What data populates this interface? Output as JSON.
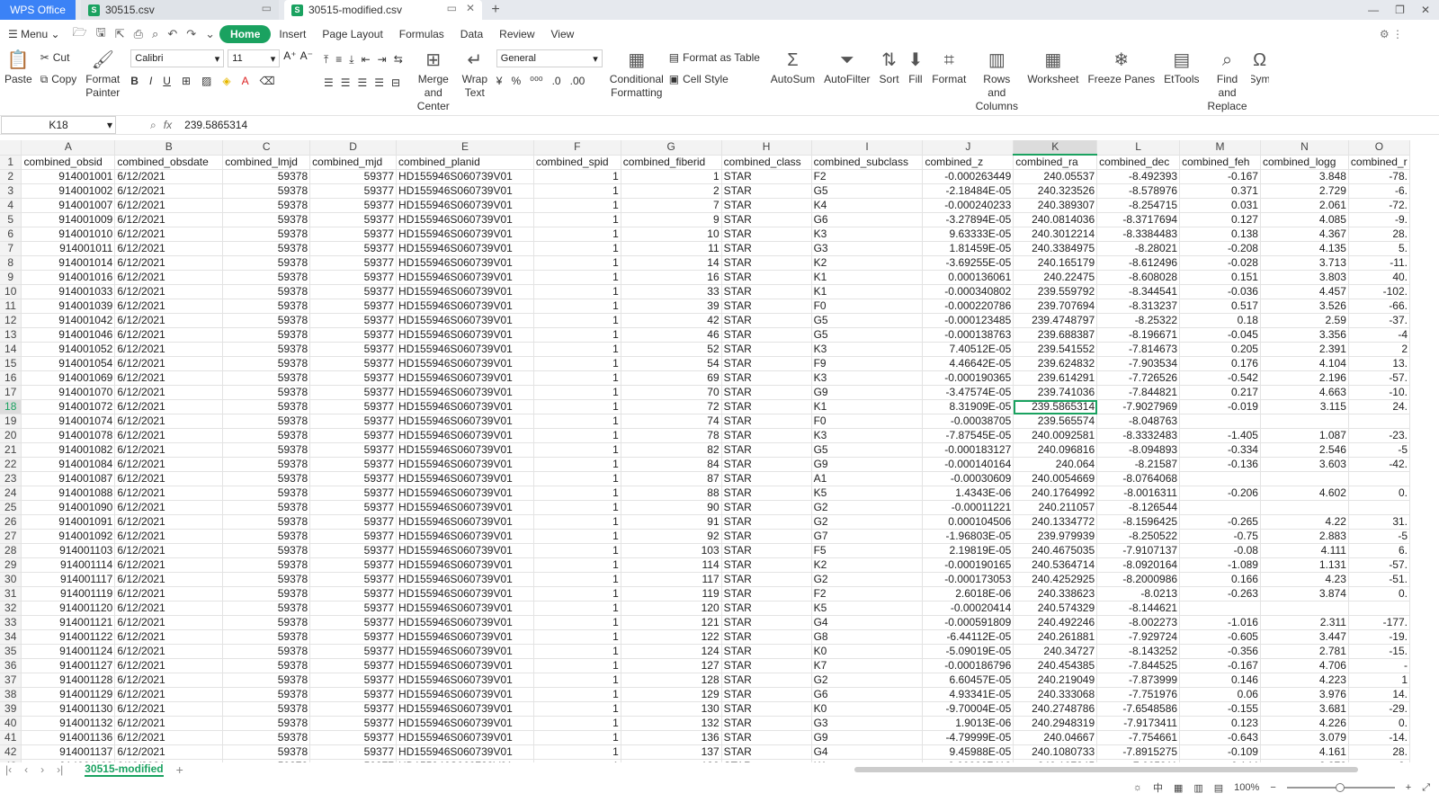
{
  "titlebar": {
    "app": "WPS Office",
    "tabs": [
      {
        "name": "30515.csv",
        "active": false
      },
      {
        "name": "30515-modified.csv",
        "active": true
      }
    ]
  },
  "menu": {
    "menu_label": "Menu",
    "items": [
      "Home",
      "Insert",
      "Page Layout",
      "Formulas",
      "Data",
      "Review",
      "View"
    ]
  },
  "ribbon": {
    "paste": "Paste",
    "cut": "Cut",
    "copy": "Copy",
    "format_painter": "Format Painter",
    "font_name": "Calibri",
    "font_size": "11",
    "merge_center": "Merge and Center",
    "wrap_text": "Wrap Text",
    "number_format": "General",
    "conditional": "Conditional Formatting",
    "format_table": "Format as Table",
    "cell_style": "Cell Style",
    "autosum": "AutoSum",
    "autofilter": "AutoFilter",
    "sort": "Sort",
    "fill": "Fill",
    "format": "Format",
    "rows_cols": "Rows and Columns",
    "worksheet": "Worksheet",
    "freeze": "Freeze Panes",
    "ettools": "EtTools",
    "find_replace": "Find and Replace",
    "sym": "Sym"
  },
  "formula": {
    "cell_ref": "K18",
    "fx": "fx",
    "value": "239.5865314"
  },
  "columns": [
    "A",
    "B",
    "C",
    "D",
    "E",
    "F",
    "G",
    "H",
    "I",
    "J",
    "K",
    "L",
    "M",
    "N",
    "O"
  ],
  "header": [
    "combined_obsid",
    "combined_obsdate",
    "combined_lmjd",
    "combined_mjd",
    "combined_planid",
    "combined_spid",
    "combined_fiberid",
    "combined_class",
    "combined_subclass",
    "combined_z",
    "combined_ra",
    "combined_dec",
    "combined_feh",
    "combined_logg",
    "combined_r"
  ],
  "rows": [
    [
      "914001001",
      "6/12/2021",
      "59378",
      "59377",
      "HD155946S060739V01",
      "1",
      "1",
      "STAR",
      "F2",
      "-0.000263449",
      "240.05537",
      "-8.492393",
      "-0.167",
      "3.848",
      "-78."
    ],
    [
      "914001002",
      "6/12/2021",
      "59378",
      "59377",
      "HD155946S060739V01",
      "1",
      "2",
      "STAR",
      "G5",
      "-2.18484E-05",
      "240.323526",
      "-8.578976",
      "0.371",
      "2.729",
      "-6."
    ],
    [
      "914001007",
      "6/12/2021",
      "59378",
      "59377",
      "HD155946S060739V01",
      "1",
      "7",
      "STAR",
      "K4",
      "-0.000240233",
      "240.389307",
      "-8.254715",
      "0.031",
      "2.061",
      "-72."
    ],
    [
      "914001009",
      "6/12/2021",
      "59378",
      "59377",
      "HD155946S060739V01",
      "1",
      "9",
      "STAR",
      "G6",
      "-3.27894E-05",
      "240.0814036",
      "-8.3717694",
      "0.127",
      "4.085",
      "-9."
    ],
    [
      "914001010",
      "6/12/2021",
      "59378",
      "59377",
      "HD155946S060739V01",
      "1",
      "10",
      "STAR",
      "K3",
      "9.63333E-05",
      "240.3012214",
      "-8.3384483",
      "0.138",
      "4.367",
      "28."
    ],
    [
      "914001011",
      "6/12/2021",
      "59378",
      "59377",
      "HD155946S060739V01",
      "1",
      "11",
      "STAR",
      "G3",
      "1.81459E-05",
      "240.3384975",
      "-8.28021",
      "-0.208",
      "4.135",
      "5."
    ],
    [
      "914001014",
      "6/12/2021",
      "59378",
      "59377",
      "HD155946S060739V01",
      "1",
      "14",
      "STAR",
      "K2",
      "-3.69255E-05",
      "240.165179",
      "-8.612496",
      "-0.028",
      "3.713",
      "-11."
    ],
    [
      "914001016",
      "6/12/2021",
      "59378",
      "59377",
      "HD155946S060739V01",
      "1",
      "16",
      "STAR",
      "K1",
      "0.000136061",
      "240.22475",
      "-8.608028",
      "0.151",
      "3.803",
      "40."
    ],
    [
      "914001033",
      "6/12/2021",
      "59378",
      "59377",
      "HD155946S060739V01",
      "1",
      "33",
      "STAR",
      "K1",
      "-0.000340802",
      "239.559792",
      "-8.344541",
      "-0.036",
      "4.457",
      "-102."
    ],
    [
      "914001039",
      "6/12/2021",
      "59378",
      "59377",
      "HD155946S060739V01",
      "1",
      "39",
      "STAR",
      "F0",
      "-0.000220786",
      "239.707694",
      "-8.313237",
      "0.517",
      "3.526",
      "-66."
    ],
    [
      "914001042",
      "6/12/2021",
      "59378",
      "59377",
      "HD155946S060739V01",
      "1",
      "42",
      "STAR",
      "G5",
      "-0.000123485",
      "239.4748797",
      "-8.25322",
      "0.18",
      "2.59",
      "-37."
    ],
    [
      "914001046",
      "6/12/2021",
      "59378",
      "59377",
      "HD155946S060739V01",
      "1",
      "46",
      "STAR",
      "G5",
      "-0.000138763",
      "239.688387",
      "-8.196671",
      "-0.045",
      "3.356",
      "-4"
    ],
    [
      "914001052",
      "6/12/2021",
      "59378",
      "59377",
      "HD155946S060739V01",
      "1",
      "52",
      "STAR",
      "K3",
      "7.40512E-05",
      "239.541552",
      "-7.814673",
      "0.205",
      "2.391",
      "2"
    ],
    [
      "914001054",
      "6/12/2021",
      "59378",
      "59377",
      "HD155946S060739V01",
      "1",
      "54",
      "STAR",
      "F9",
      "4.46642E-05",
      "239.624832",
      "-7.903534",
      "0.176",
      "4.104",
      "13."
    ],
    [
      "914001069",
      "6/12/2021",
      "59378",
      "59377",
      "HD155946S060739V01",
      "1",
      "69",
      "STAR",
      "K3",
      "-0.000190365",
      "239.614291",
      "-7.726526",
      "-0.542",
      "2.196",
      "-57."
    ],
    [
      "914001070",
      "6/12/2021",
      "59378",
      "59377",
      "HD155946S060739V01",
      "1",
      "70",
      "STAR",
      "G9",
      "-3.47574E-05",
      "239.741036",
      "-7.844821",
      "0.217",
      "4.663",
      "-10."
    ],
    [
      "914001072",
      "6/12/2021",
      "59378",
      "59377",
      "HD155946S060739V01",
      "1",
      "72",
      "STAR",
      "K1",
      "8.31909E-05",
      "239.5865314",
      "-7.9027969",
      "-0.019",
      "3.115",
      "24."
    ],
    [
      "914001074",
      "6/12/2021",
      "59378",
      "59377",
      "HD155946S060739V01",
      "1",
      "74",
      "STAR",
      "F0",
      "-0.00038705",
      "239.565574",
      "-8.048763",
      "",
      "",
      ""
    ],
    [
      "914001078",
      "6/12/2021",
      "59378",
      "59377",
      "HD155946S060739V01",
      "1",
      "78",
      "STAR",
      "K3",
      "-7.87545E-05",
      "240.0092581",
      "-8.3332483",
      "-1.405",
      "1.087",
      "-23."
    ],
    [
      "914001082",
      "6/12/2021",
      "59378",
      "59377",
      "HD155946S060739V01",
      "1",
      "82",
      "STAR",
      "G5",
      "-0.000183127",
      "240.096816",
      "-8.094893",
      "-0.334",
      "2.546",
      "-5"
    ],
    [
      "914001084",
      "6/12/2021",
      "59378",
      "59377",
      "HD155946S060739V01",
      "1",
      "84",
      "STAR",
      "G9",
      "-0.000140164",
      "240.064",
      "-8.21587",
      "-0.136",
      "3.603",
      "-42."
    ],
    [
      "914001087",
      "6/12/2021",
      "59378",
      "59377",
      "HD155946S060739V01",
      "1",
      "87",
      "STAR",
      "A1",
      "-0.00030609",
      "240.0054669",
      "-8.0764068",
      "",
      "",
      ""
    ],
    [
      "914001088",
      "6/12/2021",
      "59378",
      "59377",
      "HD155946S060739V01",
      "1",
      "88",
      "STAR",
      "K5",
      "1.4343E-06",
      "240.1764992",
      "-8.0016311",
      "-0.206",
      "4.602",
      "0."
    ],
    [
      "914001090",
      "6/12/2021",
      "59378",
      "59377",
      "HD155946S060739V01",
      "1",
      "90",
      "STAR",
      "G2",
      "-0.00011221",
      "240.211057",
      "-8.126544",
      "",
      "",
      ""
    ],
    [
      "914001091",
      "6/12/2021",
      "59378",
      "59377",
      "HD155946S060739V01",
      "1",
      "91",
      "STAR",
      "G2",
      "0.000104506",
      "240.1334772",
      "-8.1596425",
      "-0.265",
      "4.22",
      "31."
    ],
    [
      "914001092",
      "6/12/2021",
      "59378",
      "59377",
      "HD155946S060739V01",
      "1",
      "92",
      "STAR",
      "G7",
      "-1.96803E-05",
      "239.979939",
      "-8.250522",
      "-0.75",
      "2.883",
      "-5"
    ],
    [
      "914001103",
      "6/12/2021",
      "59378",
      "59377",
      "HD155946S060739V01",
      "1",
      "103",
      "STAR",
      "F5",
      "2.19819E-05",
      "240.4675035",
      "-7.9107137",
      "-0.08",
      "4.111",
      "6."
    ],
    [
      "914001114",
      "6/12/2021",
      "59378",
      "59377",
      "HD155946S060739V01",
      "1",
      "114",
      "STAR",
      "K2",
      "-0.000190165",
      "240.5364714",
      "-8.0920164",
      "-1.089",
      "1.131",
      "-57."
    ],
    [
      "914001117",
      "6/12/2021",
      "59378",
      "59377",
      "HD155946S060739V01",
      "1",
      "117",
      "STAR",
      "G2",
      "-0.000173053",
      "240.4252925",
      "-8.2000986",
      "0.166",
      "4.23",
      "-51."
    ],
    [
      "914001119",
      "6/12/2021",
      "59378",
      "59377",
      "HD155946S060739V01",
      "1",
      "119",
      "STAR",
      "F2",
      "2.6018E-06",
      "240.338623",
      "-8.0213",
      "-0.263",
      "3.874",
      "0."
    ],
    [
      "914001120",
      "6/12/2021",
      "59378",
      "59377",
      "HD155946S060739V01",
      "1",
      "120",
      "STAR",
      "K5",
      "-0.00020414",
      "240.574329",
      "-8.144621",
      "",
      "",
      ""
    ],
    [
      "914001121",
      "6/12/2021",
      "59378",
      "59377",
      "HD155946S060739V01",
      "1",
      "121",
      "STAR",
      "G4",
      "-0.000591809",
      "240.492246",
      "-8.002273",
      "-1.016",
      "2.311",
      "-177."
    ],
    [
      "914001122",
      "6/12/2021",
      "59378",
      "59377",
      "HD155946S060739V01",
      "1",
      "122",
      "STAR",
      "G8",
      "-6.44112E-05",
      "240.261881",
      "-7.929724",
      "-0.605",
      "3.447",
      "-19."
    ],
    [
      "914001124",
      "6/12/2021",
      "59378",
      "59377",
      "HD155946S060739V01",
      "1",
      "124",
      "STAR",
      "K0",
      "-5.09019E-05",
      "240.34727",
      "-8.143252",
      "-0.356",
      "2.781",
      "-15."
    ],
    [
      "914001127",
      "6/12/2021",
      "59378",
      "59377",
      "HD155946S060739V01",
      "1",
      "127",
      "STAR",
      "K7",
      "-0.000186796",
      "240.454385",
      "-7.844525",
      "-0.167",
      "4.706",
      "-"
    ],
    [
      "914001128",
      "6/12/2021",
      "59378",
      "59377",
      "HD155946S060739V01",
      "1",
      "128",
      "STAR",
      "G2",
      "6.60457E-05",
      "240.219049",
      "-7.873999",
      "0.146",
      "4.223",
      "1"
    ],
    [
      "914001129",
      "6/12/2021",
      "59378",
      "59377",
      "HD155946S060739V01",
      "1",
      "129",
      "STAR",
      "G6",
      "4.93341E-05",
      "240.333068",
      "-7.751976",
      "0.06",
      "3.976",
      "14."
    ],
    [
      "914001130",
      "6/12/2021",
      "59378",
      "59377",
      "HD155946S060739V01",
      "1",
      "130",
      "STAR",
      "K0",
      "-9.70004E-05",
      "240.2748786",
      "-7.6548586",
      "-0.155",
      "3.681",
      "-29."
    ],
    [
      "914001132",
      "6/12/2021",
      "59378",
      "59377",
      "HD155946S060739V01",
      "1",
      "132",
      "STAR",
      "G3",
      "1.9013E-06",
      "240.2948319",
      "-7.9173411",
      "0.123",
      "4.226",
      "0."
    ],
    [
      "914001136",
      "6/12/2021",
      "59378",
      "59377",
      "HD155946S060739V01",
      "1",
      "136",
      "STAR",
      "G9",
      "-4.79999E-05",
      "240.04667",
      "-7.754661",
      "-0.643",
      "3.079",
      "-14."
    ],
    [
      "914001137",
      "6/12/2021",
      "59378",
      "59377",
      "HD155946S060739V01",
      "1",
      "137",
      "STAR",
      "G4",
      "9.45988E-05",
      "240.1080733",
      "-7.8915275",
      "-0.109",
      "4.161",
      "28."
    ],
    [
      "914001138",
      "6/12/2021",
      "59378",
      "59377",
      "HD155946S060739V01",
      "1",
      "138",
      "STAR",
      "K1",
      "-0.000027419",
      "240.107345",
      "-7.665311",
      "-0.144",
      "2.372",
      "-8."
    ]
  ],
  "sheet_tab": "30515-modified",
  "status": {
    "zoom": "100%"
  },
  "colors": {
    "accent": "#1aa260",
    "wps": "#3b82f6"
  }
}
